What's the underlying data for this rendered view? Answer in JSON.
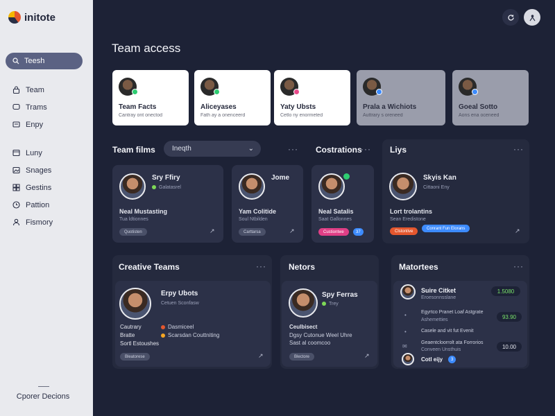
{
  "app": {
    "name": "initote"
  },
  "sidebar": {
    "search_label": "Teesh",
    "nav_group_1": [
      {
        "label": "Team",
        "icon": "lock-icon"
      },
      {
        "label": "Trams",
        "icon": "chat-icon"
      },
      {
        "label": "Enpy",
        "icon": "message-icon"
      }
    ],
    "nav_group_2": [
      {
        "label": "Luny",
        "icon": "card-icon"
      },
      {
        "label": "Snages",
        "icon": "image-icon"
      },
      {
        "label": "Gestins",
        "icon": "grid-icon"
      },
      {
        "label": "Pattion",
        "icon": "clock-icon"
      },
      {
        "label": "Fismory",
        "icon": "user-icon"
      }
    ],
    "footer": "Cporer Decions"
  },
  "page_title": "Team access",
  "access_cards": [
    {
      "title": "Team Facts",
      "subtitle": "Cantray ont onectod",
      "badge_color": "#2ecc71",
      "dim": false
    },
    {
      "title": "Aliceyases",
      "subtitle": "Fath ay a onenceerd",
      "badge_color": "#2ecc71",
      "dim": false
    },
    {
      "title": "Yaty Ubsts",
      "subtitle": "Cetlo ny enormeted",
      "badge_color": "#e94b8a",
      "dim": false
    },
    {
      "title": "Prala a Wichiots",
      "subtitle": "Auttrary s oreneed",
      "badge_color": "#3d8bfd",
      "dim": true
    },
    {
      "title": "Goeal Sotto",
      "subtitle": "Aons ena oceneed",
      "badge_color": "#3d8bfd",
      "dim": true
    }
  ],
  "team_films": {
    "title": "Team films",
    "select_value": "Ineqth",
    "cards": [
      {
        "name": "Sry Ffiry",
        "sub": "Galatasrel",
        "role": "Neal Mustasting",
        "desc": "Tua ldtionnes",
        "chips": [
          {
            "label": "Quotisten",
            "color": "#4a5068"
          }
        ]
      },
      {
        "name": "Jome",
        "sub": "",
        "role": "Yam Colitide",
        "desc": "Soul Ntbilden",
        "chips": [
          {
            "label": "Carttarsa",
            "color": "#4a5068"
          }
        ]
      }
    ]
  },
  "costrations": {
    "title": "Costrations",
    "card": {
      "role": "Neal Satalis",
      "desc": "Saat Gallonnes",
      "chips": [
        {
          "label": "Custiontwe",
          "color": "#e03f86"
        },
        {
          "label": "37",
          "color": "#3d8bfd"
        }
      ]
    }
  },
  "liys": {
    "title": "Liys",
    "card": {
      "name": "Skyis Kan",
      "sub": "Cittaoni Eny",
      "role": "Lort trolantins",
      "desc": "Sean Eredistone",
      "chips": [
        {
          "label": "Clstontive",
          "color": "#e4572e"
        },
        {
          "label": "Conrant Fun Elorans",
          "color": "#3d8bfd"
        }
      ]
    }
  },
  "creative_teams": {
    "title": "Creative Teams",
    "card": {
      "name": "Erpy Ubots",
      "sub": "Cetuen Sconfasw",
      "rows": [
        {
          "label": "Cautrary",
          "value": "Dasmiceel",
          "dot": "#e4572e"
        },
        {
          "label": "Bratte",
          "value": "Scarsdan Couttniting",
          "dot": "#f5a623"
        },
        {
          "label": "Sortl Estoushes",
          "value": ""
        }
      ],
      "chip": "Bleatorese"
    }
  },
  "netors": {
    "title": "Netors",
    "card": {
      "name": "Spy Ferras",
      "sub": "Trey",
      "rows": [
        "Ceulbisect",
        "Dgsy Cutonue Weel Uhre",
        "Sast al coomcoo"
      ],
      "chip": "Blectore"
    }
  },
  "matches": {
    "title": "Matortees",
    "rows": [
      {
        "title": "Suire Citket",
        "sub": "Eroesonnsslane",
        "value": "1.5080"
      },
      {
        "title": "Egyrtco Pranet Loaf Astgrate",
        "sub": "Ashemetties",
        "value": "93.90"
      },
      {
        "title": "Casele and vit fut Evenit",
        "sub": "",
        "value": ""
      },
      {
        "title": "Geaentcloorrolt ata Forrorios",
        "sub": "Conveen Unsthuis",
        "value": "10.00"
      },
      {
        "title": "Cotl eijy",
        "sub": "",
        "value": "",
        "chip": "3"
      }
    ]
  },
  "colors": {
    "bg": "#1d2236",
    "panel": "#252a3e",
    "card": "#2c3148",
    "sidebar": "#e9eaee",
    "accent_blue": "#3d8bfd",
    "accent_pink": "#e03f86",
    "accent_orange": "#e4572e",
    "accent_green": "#79e36a"
  },
  "icons": {
    "top_1": "refresh-icon",
    "top_2": "user-icon",
    "search": "search-icon",
    "dots": "more-dots-icon",
    "arrow": "arrow-icon"
  },
  "labels": {
    "more": "···",
    "arrow": "↗",
    "chevron": "⌄"
  }
}
